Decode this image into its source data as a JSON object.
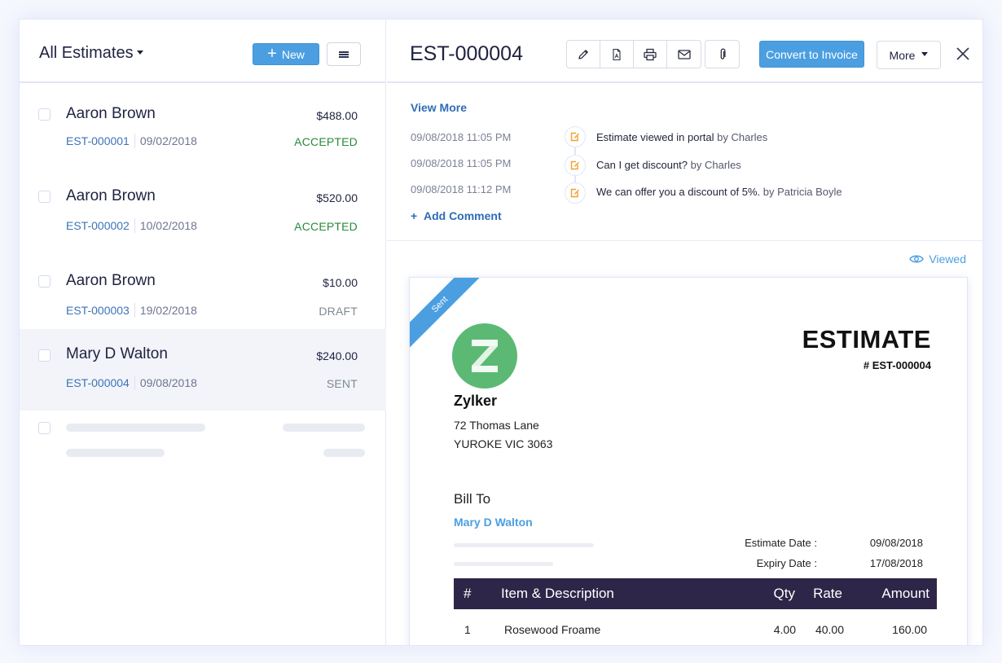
{
  "list": {
    "title": "All Estimates",
    "new_label": "New",
    "items": [
      {
        "customer": "Aaron Brown",
        "amount": "$488.00",
        "estimate_no": "EST-000001",
        "date": "09/02/2018",
        "status": "ACCEPTED",
        "status_color": "#2a8a3a"
      },
      {
        "customer": "Aaron Brown",
        "amount": "$520.00",
        "estimate_no": "EST-000002",
        "date": "10/02/2018",
        "status": "ACCEPTED",
        "status_color": "#2a8a3a"
      },
      {
        "customer": "Aaron Brown",
        "amount": "$10.00",
        "estimate_no": "EST-000003",
        "date": "19/02/2018",
        "status": "DRAFT",
        "status_color": "#7d8a90"
      },
      {
        "customer": "Mary D Walton",
        "amount": "$240.00",
        "estimate_no": "EST-000004",
        "date": "09/08/2018",
        "status": "SENT",
        "status_color": "#7d8a90"
      }
    ]
  },
  "detail": {
    "title": "EST-000004",
    "toolbar": {
      "edit_icon": "pencil-icon",
      "pdf_icon": "pdf-icon",
      "print_icon": "printer-icon",
      "email_icon": "envelope-icon",
      "attach_icon": "paperclip-icon"
    },
    "convert_label": "Convert to Invoice",
    "more_label": "More",
    "view_more_label": "View More",
    "history": [
      {
        "time": "09/08/2018  11:05 PM",
        "text": "Estimate viewed in portal",
        "by": "by Charles"
      },
      {
        "time": "09/08/2018  11:05 PM",
        "text": "Can I get discount?",
        "by": "by Charles"
      },
      {
        "time": "09/08/2018  11:12 PM",
        "text": "We can offer you a discount of 5%.",
        "by": "by Patricia Boyle"
      }
    ],
    "add_comment_label": "Add Comment",
    "viewed_label": "Viewed"
  },
  "document": {
    "ribbon": "Sent",
    "logo_letter": "Z",
    "org_name": "Zylker",
    "org_address": [
      "72 Thomas Lane",
      "YUROKE VIC 3063"
    ],
    "doc_title": "ESTIMATE",
    "doc_number": "# EST-000004",
    "bill_to_label": "Bill To",
    "bill_to_name": "Mary D Walton",
    "dates": [
      {
        "label": "Estimate Date :",
        "value": "09/08/2018"
      },
      {
        "label": "Expiry Date :",
        "value": "17/08/2018"
      }
    ],
    "table": {
      "headers": {
        "num": "#",
        "item": "Item & Description",
        "qty": "Qty",
        "rate": "Rate",
        "amount": "Amount"
      },
      "rows": [
        {
          "num": "1",
          "item": "Rosewood Froame",
          "qty": "4.00",
          "rate": "40.00",
          "amount": "160.00"
        }
      ]
    }
  },
  "colors": {
    "accent": "#4b9fe1",
    "link": "#2f6cb7",
    "table_header": "#2e2648",
    "logo_green": "#5bb974",
    "history_icon": "#f0a12a"
  }
}
